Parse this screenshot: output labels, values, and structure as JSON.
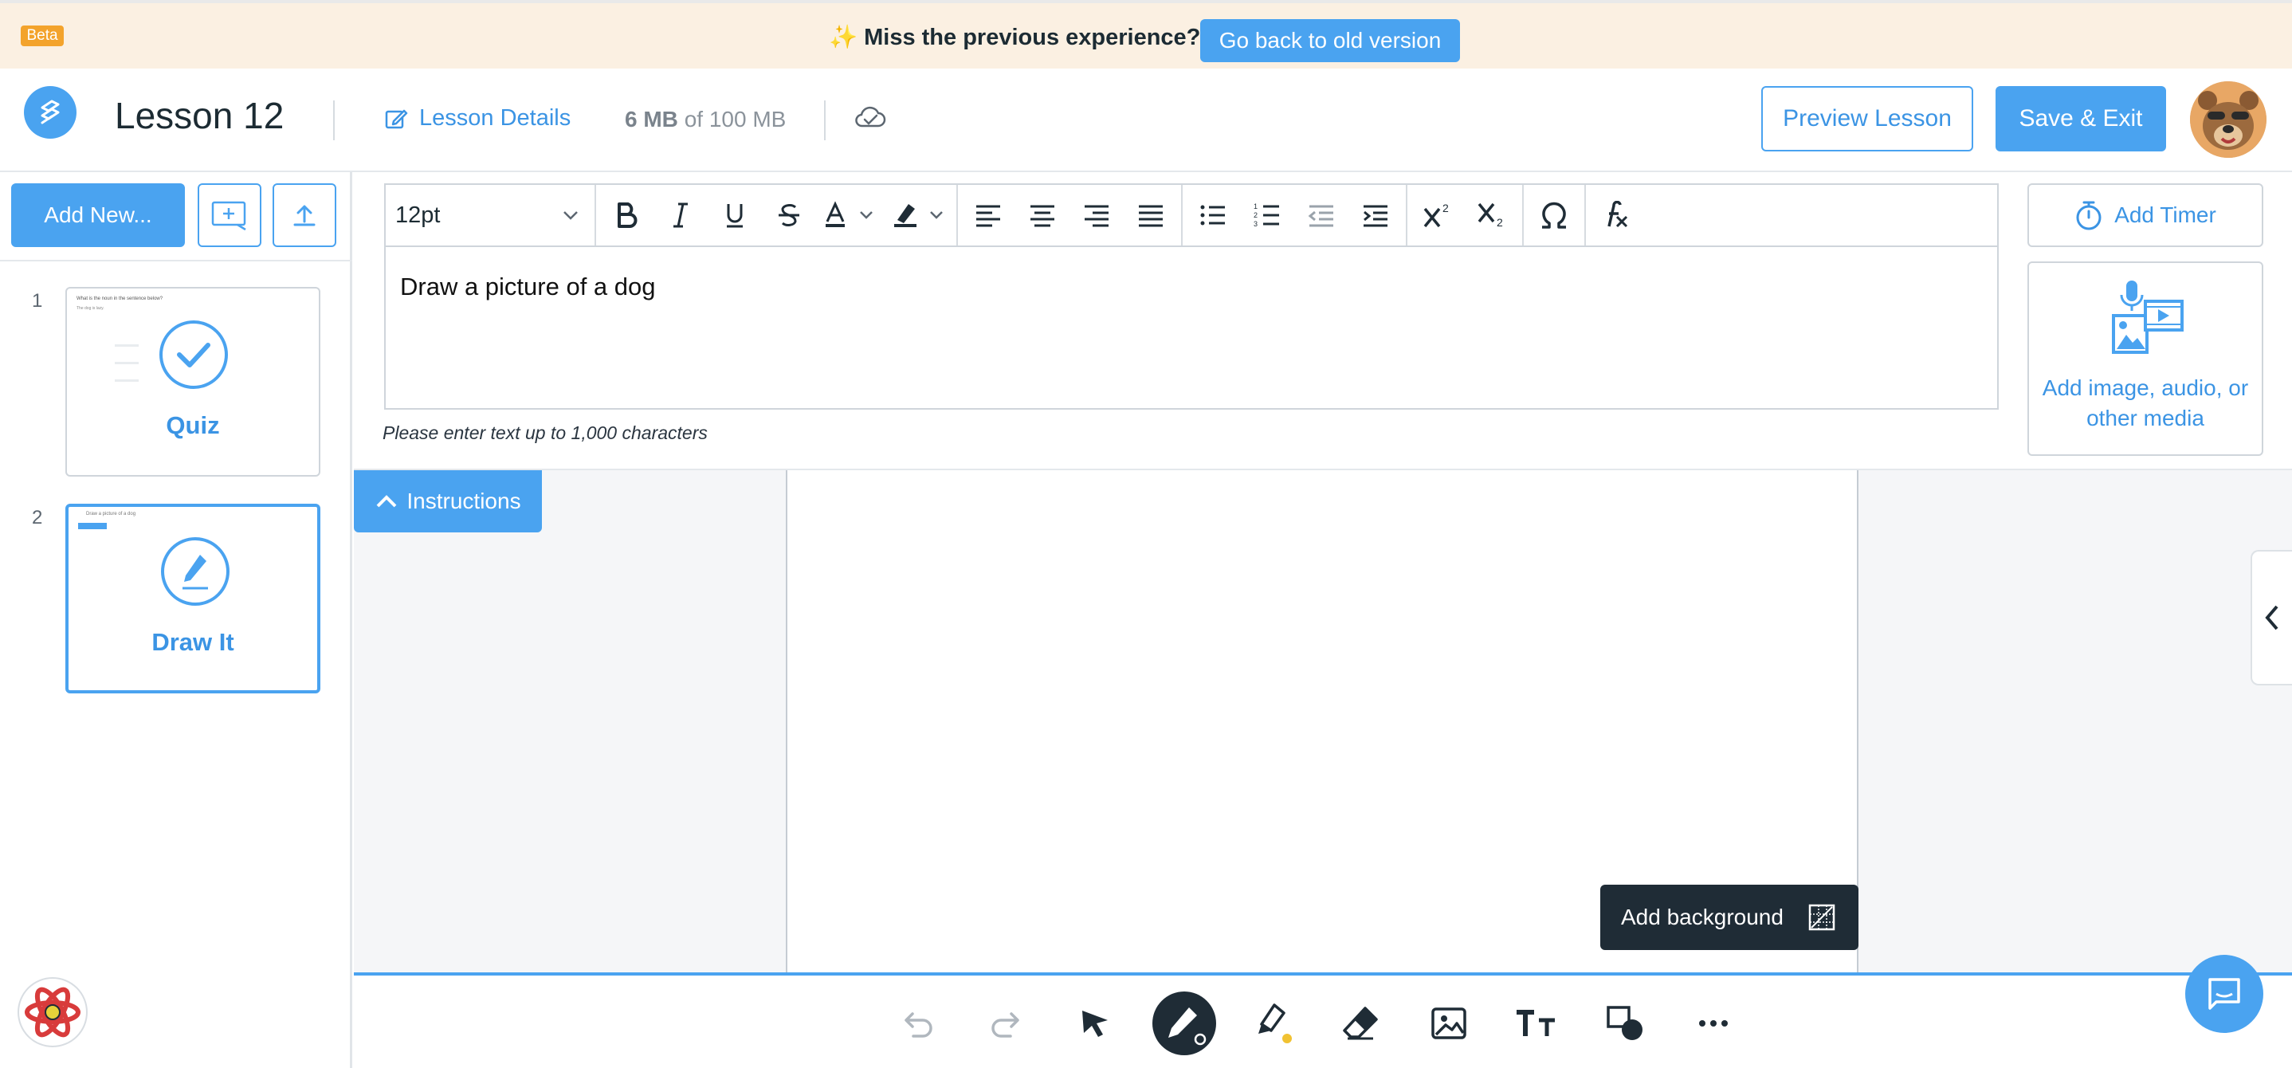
{
  "banner": {
    "beta_label": "Beta",
    "sparkle": "✨",
    "message": "Miss the previous experience?",
    "old_version_label": "Go back to old version"
  },
  "header": {
    "lesson_title": "Lesson 12",
    "lesson_details_label": "Lesson Details",
    "storage_used": "6 MB",
    "storage_of": "of 100 MB",
    "preview_label": "Preview Lesson",
    "save_label": "Save & Exit"
  },
  "sidebar": {
    "add_new_label": "Add New...",
    "slides": [
      {
        "number": "1",
        "label": "Quiz",
        "thumb_title": "What is the noun in the sentence below?",
        "thumb_sub": "The dog is lazy.",
        "icon": "checkmark-icon"
      },
      {
        "number": "2",
        "label": "Draw It",
        "thumb_title": "Draw a picture of a dog",
        "icon": "pencil-icon"
      }
    ]
  },
  "editor": {
    "font_size": "12pt",
    "content": "Draw a picture of a dog",
    "char_hint": "Please enter text up to 1,000 characters",
    "add_timer_label": "Add Timer",
    "add_media_label": "Add image, audio, or other media"
  },
  "canvas": {
    "instructions_label": "Instructions",
    "add_background_label": "Add background"
  },
  "colors": {
    "accent": "#4aa3f0",
    "dark": "#1f2c36",
    "banner_bg": "#fbf0e2",
    "beta": "#f3a32c"
  }
}
